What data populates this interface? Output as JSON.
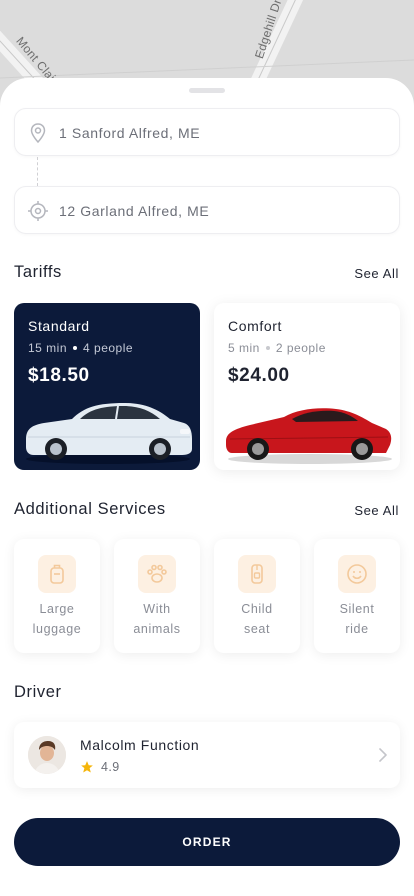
{
  "map": {
    "streets": [
      "Mont Clair St",
      "Edgehill Dr"
    ]
  },
  "route": {
    "from": "1 Sanford Alfred, ME",
    "to": "12 Garland Alfred, ME",
    "from_icon": "pin-icon",
    "to_icon": "target-icon"
  },
  "tariffs": {
    "title": "Tariffs",
    "see_all": "See All",
    "items": [
      {
        "name": "Standard",
        "time": "15 min",
        "people": "4 people",
        "price": "$18.50",
        "selected": true,
        "car_color": "#e6eef5"
      },
      {
        "name": "Comfort",
        "time": "5 min",
        "people": "2 people",
        "price": "$24.00",
        "selected": false,
        "car_color": "#c8161c"
      }
    ]
  },
  "services": {
    "title": "Additional Services",
    "see_all": "See All",
    "items": [
      {
        "line1": "Large",
        "line2": "luggage",
        "icon": "luggage-icon"
      },
      {
        "line1": "With",
        "line2": "animals",
        "icon": "paw-icon"
      },
      {
        "line1": "Child",
        "line2": "seat",
        "icon": "child-seat-icon"
      },
      {
        "line1": "Silent",
        "line2": "ride",
        "icon": "smile-icon"
      }
    ]
  },
  "driver": {
    "title": "Driver",
    "name": "Malcolm Function",
    "rating": "4.9"
  },
  "order_label": "ORDER",
  "colors": {
    "navy": "#0c1a3a",
    "accent_star": "#f5b50a",
    "icon_badge": "#fdf0e2",
    "icon_stroke": "#f3c99b"
  }
}
